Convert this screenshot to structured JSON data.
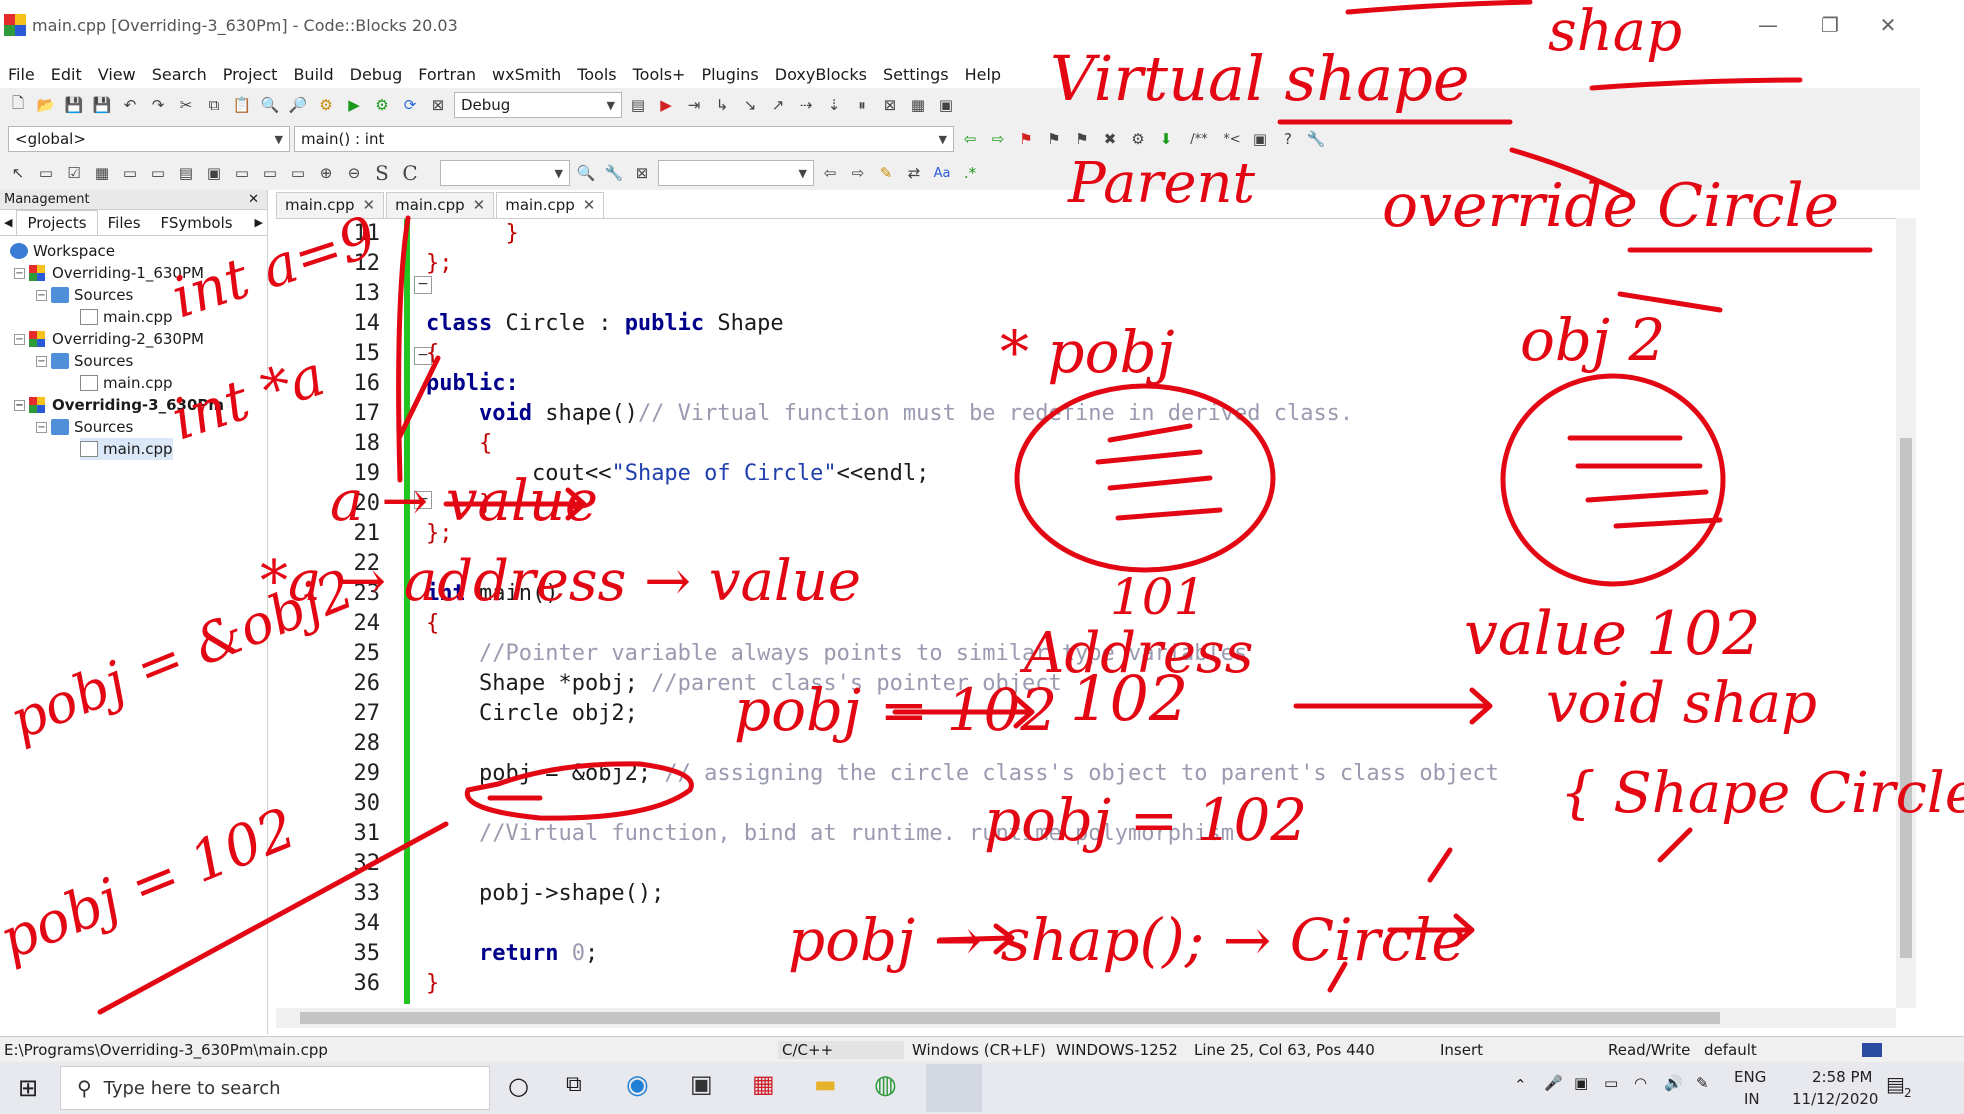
{
  "window": {
    "title": "main.cpp [Overriding-3_630Pm] - Code::Blocks 20.03",
    "minimize": "—",
    "maximize": "❐",
    "close": "✕"
  },
  "menu": [
    "File",
    "Edit",
    "View",
    "Search",
    "Project",
    "Build",
    "Debug",
    "Fortran",
    "wxSmith",
    "Tools",
    "Tools+",
    "Plugins",
    "DoxyBlocks",
    "Settings",
    "Help"
  ],
  "toolbar": {
    "build_target": "Debug",
    "scope": "<global>",
    "function": "main() : int",
    "doxy_block": "/**",
    "doxy_line": "*<"
  },
  "management": {
    "title": "Management",
    "close": "✕",
    "tabs": [
      "Projects",
      "Files",
      "FSymbols"
    ],
    "workspace": "Workspace",
    "projects": [
      {
        "name": "Overriding-1_630PM",
        "folder": "Sources",
        "file": "main.cpp"
      },
      {
        "name": "Overriding-2_630PM",
        "folder": "Sources",
        "file": "main.cpp"
      },
      {
        "name": "Overriding-3_630Pm",
        "folder": "Sources",
        "file": "main.cpp"
      }
    ]
  },
  "editor": {
    "tabs": [
      "main.cpp",
      "main.cpp",
      "main.cpp"
    ],
    "line_numbers": [
      "11",
      "12",
      "13",
      "14",
      "15",
      "16",
      "17",
      "18",
      "19",
      "20",
      "21",
      "22",
      "23",
      "24",
      "25",
      "26",
      "27",
      "28",
      "29",
      "30",
      "31",
      "32",
      "33",
      "34",
      "35",
      "36"
    ],
    "code": {
      "l11": "}",
      "l12": "};",
      "l14_kw1": "class",
      "l14_id": " Circle : ",
      "l14_kw2": "public",
      "l14_id2": " Shape",
      "l15": "{",
      "l16": "public:",
      "l17_kw": "void",
      "l17_id": " shape()",
      "l17_cm": "// Virtual function must be redefine in derived class.",
      "l18": "{",
      "l19_id": "cout<<",
      "l19_st": "\"Shape of Circle\"",
      "l19_id2": "<<endl;",
      "l20": "}",
      "l21": "};",
      "l23_kw": "int",
      "l23_id": " main()",
      "l24": "{",
      "l25_cm": "//Pointer variable always points to similar type variables",
      "l26_id": "Shape *pobj; ",
      "l26_cm": "//parent class's pointer object",
      "l27_id": "Circle obj2;",
      "l29_id": "pobj = &obj2; ",
      "l29_cm": "// assigning the circle class's object to parent's class object",
      "l31_cm": "//Virtual function, bind at runtime. runtime polymorphism",
      "l33_id": "pobj->shape();",
      "l35_kw": "return",
      "l35_num": " 0",
      "l35_end": ";",
      "l36": "}"
    }
  },
  "status": {
    "path": "E:\\Programs\\Overriding-3_630Pm\\main.cpp",
    "language": "C/C++",
    "eol": "Windows (CR+LF)",
    "encoding": "WINDOWS-1252",
    "position": "Line 25, Col 63, Pos 440",
    "mode": "Insert",
    "access": "Read/Write",
    "profile": "default"
  },
  "taskbar": {
    "search_placeholder": "Type here to search",
    "lang": "ENG",
    "region": "IN",
    "time": "2:58 PM",
    "date": "11/12/2020",
    "notifications": "2"
  },
  "annotations": {
    "virtual_shape": "Virtual shape",
    "shap": "shap",
    "parent": "Parent",
    "override_circle": "override Circle",
    "int_a9": "int a=9",
    "int_a": "int *a",
    "pobj_star": "* pobj",
    "obj2": "obj 2",
    "a_value": "a → value",
    "star_a_address": "*a → address → value",
    "num_101": "101",
    "address": "Address",
    "value102": "value 102",
    "voidshap": "void shap",
    "shape_circle": "{ Shape Circle }",
    "num_102": "102",
    "pobj_eq_102": "pobj = 102",
    "pobj_amp": "pobj = &obj2",
    "pobj_102": "pobj = 102",
    "call": "pobj → shap(); → Circle"
  },
  "colors": {
    "ink": "#e30613",
    "keyword": "#00008b",
    "comment": "#9a9ab0",
    "string": "#1f3fae",
    "change_bar": "#22c522"
  }
}
